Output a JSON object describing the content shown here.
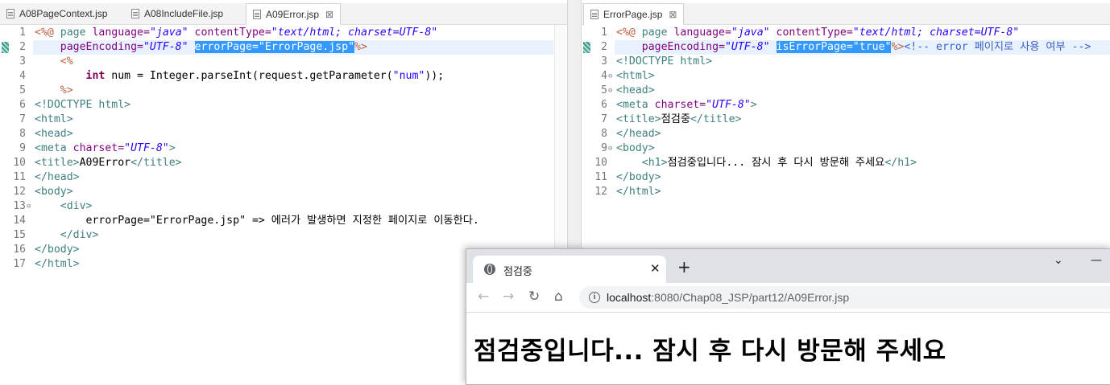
{
  "left_editor": {
    "tabs": [
      {
        "label": "A08PageContext.jsp"
      },
      {
        "label": "A08IncludeFile.jsp"
      },
      {
        "label": "A09Error.jsp",
        "active": true
      }
    ],
    "close_glyph": "⊠",
    "lines": [
      {
        "n": "1",
        "segs": [
          [
            "d",
            "<%@ "
          ],
          [
            "k2",
            "page "
          ],
          [
            "a",
            "language="
          ],
          [
            "s",
            "\"java\" "
          ],
          [
            "a",
            "contentType="
          ],
          [
            "s",
            "\"text/html; charset=UTF-8\""
          ]
        ]
      },
      {
        "n": "2",
        "segs": [
          [
            "p",
            "    "
          ],
          [
            "a",
            "pageEncoding="
          ],
          [
            "s",
            "\"UTF-8\""
          ],
          [
            "p",
            " "
          ],
          [
            "sel",
            "errorPage=\"ErrorPage.jsp\""
          ],
          [
            "d",
            "%>"
          ]
        ]
      },
      {
        "n": "3",
        "segs": [
          [
            "d",
            "    <%"
          ]
        ]
      },
      {
        "n": "4",
        "segs": [
          [
            "p",
            "        "
          ],
          [
            "k",
            "int"
          ],
          [
            "p",
            " num = Integer.parseInt(request.getParameter("
          ],
          [
            "s2",
            "\"num\""
          ],
          [
            "p",
            "));"
          ]
        ]
      },
      {
        "n": "5",
        "segs": [
          [
            "d",
            "    %>"
          ]
        ]
      },
      {
        "n": "6",
        "segs": [
          [
            "t",
            "<!DOCTYPE html>"
          ]
        ]
      },
      {
        "n": "7",
        "segs": [
          [
            "t",
            "<html>"
          ]
        ]
      },
      {
        "n": "8",
        "segs": [
          [
            "t",
            "<head>"
          ]
        ]
      },
      {
        "n": "9",
        "segs": [
          [
            "t",
            "<meta "
          ],
          [
            "a",
            "charset="
          ],
          [
            "s",
            "\"UTF-8\""
          ],
          [
            "t",
            ">"
          ]
        ]
      },
      {
        "n": "10",
        "segs": [
          [
            "t",
            "<title>"
          ],
          [
            "p",
            "A09Error"
          ],
          [
            "t",
            "</title>"
          ]
        ]
      },
      {
        "n": "11",
        "segs": [
          [
            "t",
            "</head>"
          ]
        ]
      },
      {
        "n": "12",
        "segs": [
          [
            "t",
            "<body>"
          ]
        ]
      },
      {
        "n": "13",
        "segs": [
          [
            "t",
            "    <div>"
          ]
        ]
      },
      {
        "n": "14",
        "segs": [
          [
            "p",
            "        errorPage=\"ErrorPage.jsp\" => 에러가 발생하면 지정한 페이지로 이동한다."
          ]
        ]
      },
      {
        "n": "15",
        "segs": [
          [
            "t",
            "    </div>"
          ]
        ]
      },
      {
        "n": "16",
        "segs": [
          [
            "t",
            "</body>"
          ]
        ]
      },
      {
        "n": "17",
        "segs": [
          [
            "t",
            "</html>"
          ]
        ]
      }
    ]
  },
  "right_editor": {
    "tabs": [
      {
        "label": "ErrorPage.jsp",
        "active": true
      }
    ],
    "close_glyph": "⊠",
    "lines": [
      {
        "n": "1",
        "segs": [
          [
            "d",
            "<%@ "
          ],
          [
            "k2",
            "page "
          ],
          [
            "a",
            "language="
          ],
          [
            "s",
            "\"java\" "
          ],
          [
            "a",
            "contentType="
          ],
          [
            "s",
            "\"text/html; charset=UTF-8\""
          ]
        ]
      },
      {
        "n": "2",
        "segs": [
          [
            "p",
            "    "
          ],
          [
            "a",
            "pageEncoding="
          ],
          [
            "s",
            "\"UTF-8\""
          ],
          [
            "p",
            " "
          ],
          [
            "sel",
            "isErrorPage=\"true\""
          ],
          [
            "d",
            "%>"
          ],
          [
            "c",
            "<!-- error 페이지로 사용 여부 -->"
          ]
        ]
      },
      {
        "n": "3",
        "segs": [
          [
            "t",
            "<!DOCTYPE html>"
          ]
        ]
      },
      {
        "n": "4",
        "segs": [
          [
            "t",
            "<html>"
          ]
        ]
      },
      {
        "n": "5",
        "segs": [
          [
            "t",
            "<head>"
          ]
        ]
      },
      {
        "n": "6",
        "segs": [
          [
            "t",
            "<meta "
          ],
          [
            "a",
            "charset="
          ],
          [
            "s",
            "\"UTF-8\""
          ],
          [
            "t",
            ">"
          ]
        ]
      },
      {
        "n": "7",
        "segs": [
          [
            "t",
            "<title>"
          ],
          [
            "p",
            "점검중"
          ],
          [
            "t",
            "</title>"
          ]
        ]
      },
      {
        "n": "8",
        "segs": [
          [
            "t",
            "</head>"
          ]
        ]
      },
      {
        "n": "9",
        "segs": [
          [
            "t",
            "<body>"
          ]
        ]
      },
      {
        "n": "10",
        "segs": [
          [
            "t",
            "    <h1>"
          ],
          [
            "p",
            "점검중입니다... 잠시 후 다시 방문해 주세요"
          ],
          [
            "t",
            "</h1>"
          ]
        ]
      },
      {
        "n": "11",
        "segs": [
          [
            "t",
            "</body>"
          ]
        ]
      },
      {
        "n": "12",
        "segs": [
          [
            "t",
            "</html>"
          ]
        ]
      }
    ]
  },
  "browser": {
    "tab_title": "점검중",
    "tab_close": "✕",
    "new_tab": "+",
    "window_controls": {
      "minimize_menu": "⌄",
      "minimize": "—"
    },
    "nav": {
      "back": "←",
      "forward": "→",
      "reload": "↻",
      "home": "⌂"
    },
    "url_host": "localhost",
    "url_rest": ":8080/Chap08_JSP/part12/A09Error.jsp",
    "info_icon": "i",
    "heading": "점검중입니다... 잠시 후 다시 방문해 주세요"
  },
  "colors": {
    "keyword": "#7f0055",
    "directive": "#bf5f3f",
    "attribute": "#7f007f",
    "string": "#2a00ff",
    "tag": "#3f7f7f",
    "comment": "#3f5fbf",
    "selection": "#3399ff",
    "current_line": "#e8f2fe"
  }
}
